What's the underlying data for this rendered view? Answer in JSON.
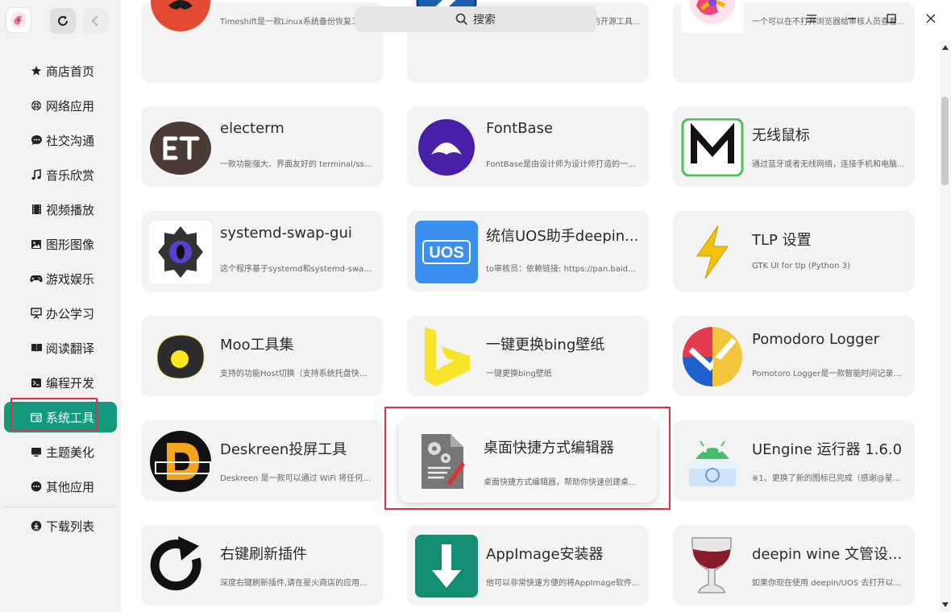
{
  "search": {
    "label": "搜索"
  },
  "sidebar": {
    "items": [
      {
        "label": "商店首页",
        "icon": "star-icon"
      },
      {
        "label": "网络应用",
        "icon": "globe-icon"
      },
      {
        "label": "社交沟通",
        "icon": "chat-icon"
      },
      {
        "label": "音乐欣赏",
        "icon": "music-icon"
      },
      {
        "label": "视频播放",
        "icon": "film-icon"
      },
      {
        "label": "图形图像",
        "icon": "image-icon"
      },
      {
        "label": "游戏娱乐",
        "icon": "gamepad-icon"
      },
      {
        "label": "办公学习",
        "icon": "presentation-icon"
      },
      {
        "label": "阅读翻译",
        "icon": "book-icon"
      },
      {
        "label": "编程开发",
        "icon": "terminal-icon"
      },
      {
        "label": "系统工具",
        "icon": "system-icon",
        "active": true
      },
      {
        "label": "主题美化",
        "icon": "monitor-icon"
      },
      {
        "label": "其他应用",
        "icon": "more-icon"
      }
    ],
    "download": {
      "label": "下载列表",
      "icon": "download-icon"
    }
  },
  "apps": [
    {
      "title": "",
      "desc": "Timeshift是一款Linux系统备份恢复工具..."
    },
    {
      "title": "",
      "desc": "Ventoy是一个制作可启动U盘的开源工具..."
    },
    {
      "title": "",
      "desc": "一个可以在不打开浏览器给审核人员查看..."
    },
    {
      "title": "electerm",
      "desc": "一款功能强大、界面友好的 terminal/ssh/..."
    },
    {
      "title": "FontBase",
      "desc": "FontBase是由设计师为设计师打造的一..."
    },
    {
      "title": "无线鼠标",
      "desc": "通过蓝牙或者无线网络，连接手机和电脑..."
    },
    {
      "title": "systemd-swap-gui",
      "desc": "这个程序基于systemd和systemd-swap来..."
    },
    {
      "title": "统信UOS助手deepin...",
      "desc": "to审核员：依赖链接: https://pan.baidu.co..."
    },
    {
      "title": "TLP 设置",
      "desc": "GTK UI for tlp (Python 3)"
    },
    {
      "title": "Moo工具集",
      "desc": "支持的功能Host切换（支持系统托盘快速..."
    },
    {
      "title": "一键更换bing壁纸",
      "desc": "一键更换bing壁纸"
    },
    {
      "title": "Pomodoro Logger",
      "desc": "Pomotoro Logger是一款智能时间记录器..."
    },
    {
      "title": "Deskreen投屏工具",
      "desc": "Deskreen 是一款可以通过 WiFi 将任何带..."
    },
    {
      "title": "桌面快捷方式编辑器",
      "desc": "桌面快捷方式编辑器，帮助你快速创建桌..."
    },
    {
      "title": "UEngine 运行器 1.6.0",
      "desc": "※1、更换了新的图标已完成（感谢@星..."
    },
    {
      "title": "右键刷新插件",
      "desc": "深度右键刷新插件,请在星火商店的应用..."
    },
    {
      "title": "AppImage安装器",
      "desc": "他可以非常快速方便的将AppImage软件..."
    },
    {
      "title": "deepin wine 文管设...",
      "desc": "如果你现在使用 deepin/UOS 去打开以前..."
    }
  ],
  "icons": {
    "uos_text": "UOS"
  },
  "colors": {
    "accent": "#139a7c",
    "highlight": "#e0304e"
  }
}
